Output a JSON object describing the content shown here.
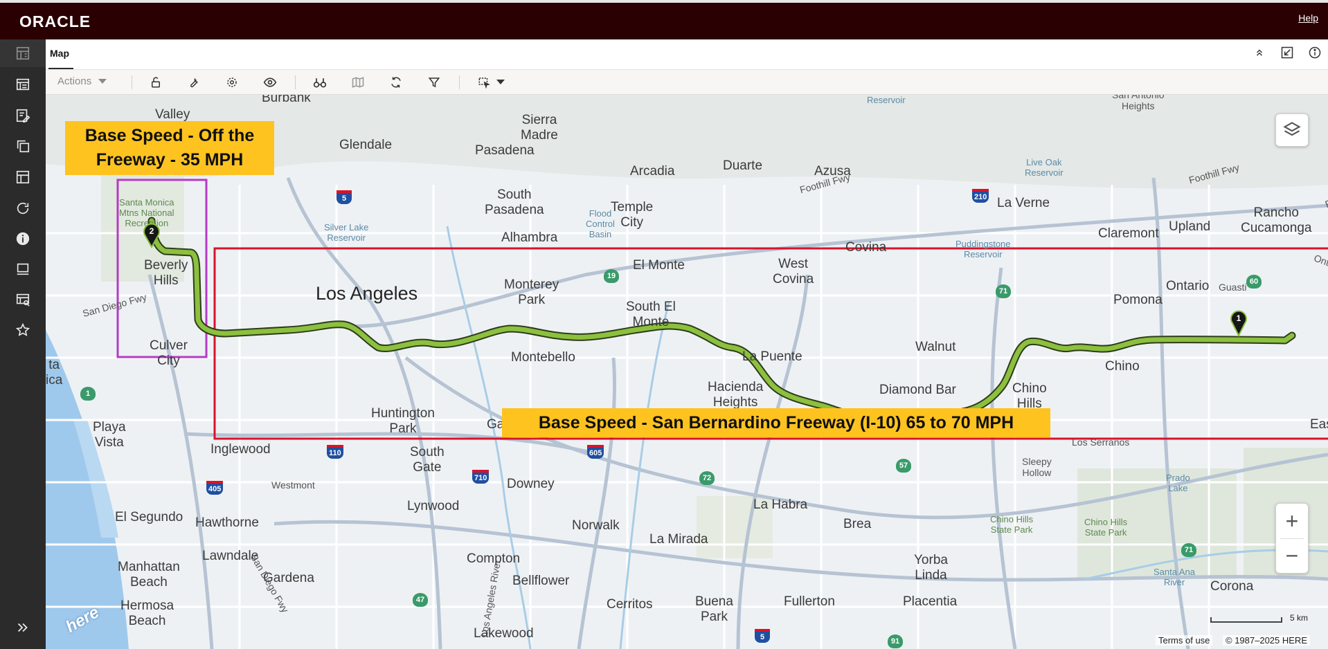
{
  "header": {
    "logo": "ORACLE",
    "help": "Help"
  },
  "tab": {
    "title": "Map"
  },
  "toolbar": {
    "actions_label": "Actions"
  },
  "map": {
    "places": [
      {
        "text": "Burbank",
        "cls": ""
      },
      {
        "text": "Valley",
        "cls": ""
      },
      {
        "text": "Sierra\nMadre",
        "cls": ""
      },
      {
        "text": "Glendale",
        "cls": ""
      },
      {
        "text": "Pasadena",
        "cls": ""
      },
      {
        "text": "Arcadia",
        "cls": ""
      },
      {
        "text": "Duarte",
        "cls": ""
      },
      {
        "text": "Azusa",
        "cls": ""
      },
      {
        "text": "South\nPasadena",
        "cls": ""
      },
      {
        "text": "Temple\nCity",
        "cls": ""
      },
      {
        "text": "La Verne",
        "cls": ""
      },
      {
        "text": "Alhambra",
        "cls": ""
      },
      {
        "text": "Claremont",
        "cls": ""
      },
      {
        "text": "Upland",
        "cls": ""
      },
      {
        "text": "Rancho\nCucamonga",
        "cls": ""
      },
      {
        "text": "Covina",
        "cls": ""
      },
      {
        "text": "West\nCovina",
        "cls": ""
      },
      {
        "text": "El Monte",
        "cls": ""
      },
      {
        "text": "Monterey\nPark",
        "cls": ""
      },
      {
        "text": "Los Angeles",
        "cls": "big"
      },
      {
        "text": "South El\nMonte",
        "cls": ""
      },
      {
        "text": "Pomona",
        "cls": ""
      },
      {
        "text": "Ontario",
        "cls": ""
      },
      {
        "text": "Montebello",
        "cls": ""
      },
      {
        "text": "La Puente",
        "cls": ""
      },
      {
        "text": "Walnut",
        "cls": ""
      },
      {
        "text": "Chino",
        "cls": ""
      },
      {
        "text": "Hacienda\nHeights",
        "cls": ""
      },
      {
        "text": "Diamond Bar",
        "cls": ""
      },
      {
        "text": "Chino\nHills",
        "cls": ""
      },
      {
        "text": "Culver\nCity",
        "cls": ""
      },
      {
        "text": "Beverly\nHills",
        "cls": ""
      },
      {
        "text": "Huntington\nPark",
        "cls": ""
      },
      {
        "text": "Playa\nVista",
        "cls": ""
      },
      {
        "text": "Inglewood",
        "cls": ""
      },
      {
        "text": "South\nGate",
        "cls": ""
      },
      {
        "text": "Downey",
        "cls": ""
      },
      {
        "text": "Westmont",
        "cls": "small"
      },
      {
        "text": "Lynwood",
        "cls": ""
      },
      {
        "text": "El Segundo",
        "cls": ""
      },
      {
        "text": "Hawthorne",
        "cls": ""
      },
      {
        "text": "Norwalk",
        "cls": ""
      },
      {
        "text": "La Mirada",
        "cls": ""
      },
      {
        "text": "La Habra",
        "cls": ""
      },
      {
        "text": "Brea",
        "cls": ""
      },
      {
        "text": "Lawndale",
        "cls": ""
      },
      {
        "text": "Compton",
        "cls": ""
      },
      {
        "text": "Manhattan\nBeach",
        "cls": ""
      },
      {
        "text": "Gardena",
        "cls": ""
      },
      {
        "text": "Bellflower",
        "cls": ""
      },
      {
        "text": "Yorba\nLinda",
        "cls": ""
      },
      {
        "text": "Hermosa\nBeach",
        "cls": ""
      },
      {
        "text": "Cerritos",
        "cls": ""
      },
      {
        "text": "Buena\nPark",
        "cls": ""
      },
      {
        "text": "Fullerton",
        "cls": ""
      },
      {
        "text": "Placentia",
        "cls": ""
      },
      {
        "text": "Corona",
        "cls": ""
      },
      {
        "text": "Lakewood",
        "cls": ""
      },
      {
        "text": "Eastvale",
        "cls": ""
      },
      {
        "text": "Gardens",
        "cls": ""
      },
      {
        "text": "Guasti",
        "cls": "small"
      },
      {
        "text": "Los Serranos",
        "cls": "small"
      },
      {
        "text": "Sleepy\nHollow",
        "cls": "small"
      },
      {
        "text": "Prado\nLake",
        "cls": "blue"
      },
      {
        "text": "Live Oak\nReservoir",
        "cls": "blue"
      },
      {
        "text": "Puddingstone\nReservoir",
        "cls": "blue"
      },
      {
        "text": "Flood\nControl\nBasin",
        "cls": "blue"
      },
      {
        "text": "Silver Lake\nReservoir",
        "cls": "blue"
      },
      {
        "text": "Reservoir",
        "cls": "blue"
      },
      {
        "text": "San Antonio\nHeights",
        "cls": "small"
      },
      {
        "text": "Santa Monica\nMtns National\nRecreation",
        "cls": "green"
      },
      {
        "text": "Chino Hills\nState Park",
        "cls": "green"
      },
      {
        "text": "Chino Hills\nState Park",
        "cls": "green"
      },
      {
        "text": "Santa Ana\nRiver",
        "cls": "blue"
      },
      {
        "text": "Foothill Fwy",
        "cls": "small"
      },
      {
        "text": "Foothill Fwy",
        "cls": "small"
      },
      {
        "text": "Foothill Fwy",
        "cls": "small"
      },
      {
        "text": "San Diego Fwy",
        "cls": "small"
      },
      {
        "text": "San Diego Fwy",
        "cls": "small"
      },
      {
        "text": "Ontario Fwy",
        "cls": "small"
      },
      {
        "text": "Los Angeles River",
        "cls": "small"
      },
      {
        "text": "ta\nica",
        "cls": ""
      }
    ],
    "shields": [
      "5",
      "210",
      "19",
      "71",
      "60",
      "110",
      "710",
      "605",
      "405",
      "72",
      "57",
      "47",
      "91",
      "5",
      "71",
      "1"
    ],
    "callout_off_freeway": "Base Speed  - Off the\nFreeway - 35 MPH",
    "callout_freeway": "Base Speed - San Bernardino Freeway (I-10) 65 to 70 MPH",
    "marker_start": "1",
    "marker_end": "2",
    "watermark": "here",
    "scale": "5 km",
    "terms": "Terms of use",
    "copyright": "© 1987–2025 HERE",
    "zoom_in": "+",
    "zoom_out": "−"
  }
}
